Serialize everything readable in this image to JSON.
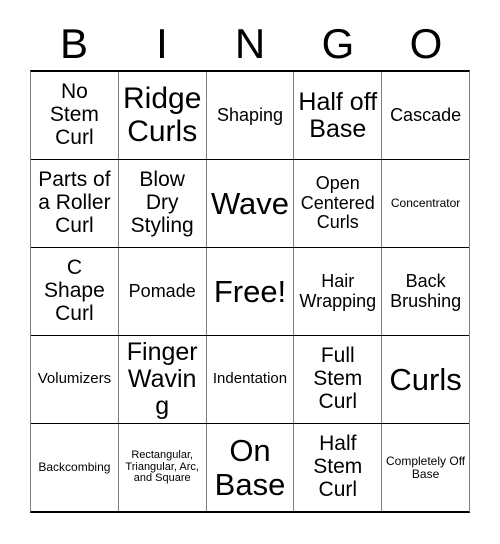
{
  "card": {
    "header_letters": [
      "B",
      "I",
      "N",
      "G",
      "O"
    ],
    "rows": [
      [
        {
          "text": "No Stem Curl",
          "size": "lg",
          "free": false
        },
        {
          "text": "Ridge Curls",
          "size": "xxl",
          "free": false
        },
        {
          "text": "Shaping",
          "size": "md",
          "free": false
        },
        {
          "text": "Half off Base",
          "size": "xl",
          "free": false
        },
        {
          "text": "Cascade",
          "size": "md",
          "free": false
        }
      ],
      [
        {
          "text": "Parts of a Roller Curl",
          "size": "lg",
          "free": false
        },
        {
          "text": "Blow Dry Styling",
          "size": "lg",
          "free": false
        },
        {
          "text": "Wave",
          "size": "xxl",
          "free": false
        },
        {
          "text": "Open Centered Curls",
          "size": "md",
          "free": false
        },
        {
          "text": "Concentrator",
          "size": "xs",
          "free": false
        }
      ],
      [
        {
          "text": "C Shape Curl",
          "size": "lg",
          "free": false
        },
        {
          "text": "Pomade",
          "size": "md",
          "free": false
        },
        {
          "text": "Free!",
          "size": "xxl",
          "free": true
        },
        {
          "text": "Hair Wrapping",
          "size": "md",
          "free": false
        },
        {
          "text": "Back Brushing",
          "size": "md",
          "free": false
        }
      ],
      [
        {
          "text": "Volumizers",
          "size": "sm",
          "free": false
        },
        {
          "text": "Finger Waving",
          "size": "xl",
          "free": false
        },
        {
          "text": "Indentation",
          "size": "sm",
          "free": false
        },
        {
          "text": "Full Stem Curl",
          "size": "lg",
          "free": false
        },
        {
          "text": "Curls",
          "size": "xxl",
          "free": false
        }
      ],
      [
        {
          "text": "Backcombing",
          "size": "xs",
          "free": false
        },
        {
          "text": "Rectangular, Triangular, Arc, and Square",
          "size": "xxs",
          "free": false
        },
        {
          "text": "On Base",
          "size": "xxl",
          "free": false
        },
        {
          "text": "Half Stem Curl",
          "size": "lg",
          "free": false
        },
        {
          "text": "Completely Off Base",
          "size": "xs",
          "free": false
        }
      ]
    ]
  },
  "colors": {
    "background": "#ffffff",
    "text": "#000000",
    "border_horizontal": "#000000",
    "border_vertical": "#808080"
  }
}
